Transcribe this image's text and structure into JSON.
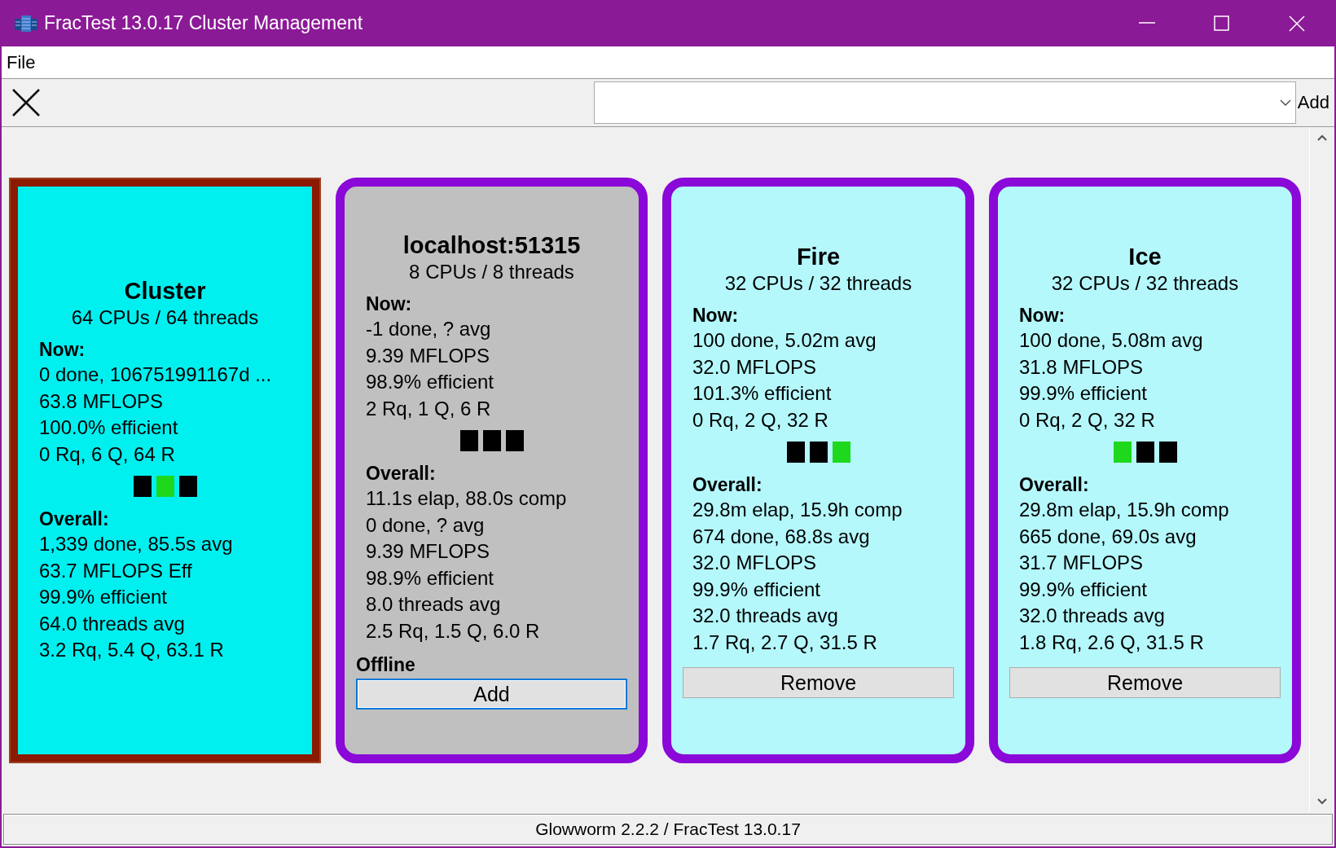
{
  "window": {
    "title": "FracTest 13.0.17 Cluster Management"
  },
  "menu": [
    "File"
  ],
  "toolbar": {
    "add_button": "Add"
  },
  "cards": [
    {
      "kind": "cluster",
      "color": "#00f0f0",
      "title": "Cluster",
      "subtitle": "64 CPUs / 64 threads",
      "now_label": "Now:",
      "now": [
        "0 done, 106751991167d ...",
        "63.8 MFLOPS",
        "100.0% efficient",
        "0 Rq, 6 Q, 64 R"
      ],
      "indicators": [
        {
          "on": false
        },
        {
          "on": true
        },
        {
          "on": false
        }
      ],
      "overall_label": "Overall:",
      "overall": [
        "1,339 done, 85.5s avg",
        "63.7 MFLOPS Eff",
        "99.9% efficient",
        "64.0 threads avg",
        "3.2 Rq, 5.4 Q, 63.1 R"
      ]
    },
    {
      "kind": "node",
      "color": "#c0c0c0",
      "title": "localhost:51315",
      "subtitle": "8 CPUs / 8 threads",
      "now_label": "Now:",
      "now": [
        "-1 done, ? avg",
        "9.39 MFLOPS",
        "98.9% efficient",
        "2 Rq, 1 Q, 6 R"
      ],
      "indicators": [
        {
          "on": false
        },
        {
          "on": false
        },
        {
          "on": false
        }
      ],
      "overall_label": "Overall:",
      "overall": [
        "11.1s elap, 88.0s comp",
        "0 done, ? avg",
        "9.39 MFLOPS",
        "98.9% efficient",
        "8.0 threads avg",
        "2.5 Rq, 1.5 Q, 6.0 R"
      ],
      "status": "Offline",
      "button": {
        "label": "Add",
        "focused": true
      }
    },
    {
      "kind": "node",
      "color": "#b4f8fc",
      "title": "Fire",
      "subtitle": "32 CPUs / 32 threads",
      "now_label": "Now:",
      "now": [
        "100 done, 5.02m avg",
        "32.0 MFLOPS",
        "101.3% efficient",
        "0 Rq, 2 Q, 32 R"
      ],
      "indicators": [
        {
          "on": false
        },
        {
          "on": false
        },
        {
          "on": true
        }
      ],
      "overall_label": "Overall:",
      "overall": [
        "29.8m elap, 15.9h comp",
        "674 done, 68.8s avg",
        "32.0 MFLOPS",
        "99.9% efficient",
        "32.0 threads avg",
        "1.7 Rq, 2.7 Q, 31.5 R"
      ],
      "button": {
        "label": "Remove",
        "focused": false
      }
    },
    {
      "kind": "node",
      "color": "#b4f8fc",
      "title": "Ice",
      "subtitle": "32 CPUs / 32 threads",
      "now_label": "Now:",
      "now": [
        "100 done, 5.08m avg",
        "31.8 MFLOPS",
        "99.9% efficient",
        "0 Rq, 2 Q, 32 R"
      ],
      "indicators": [
        {
          "on": true
        },
        {
          "on": false
        },
        {
          "on": false
        }
      ],
      "overall_label": "Overall:",
      "overall": [
        "29.8m elap, 15.9h comp",
        "665 done, 69.0s avg",
        "31.7 MFLOPS",
        "99.9% efficient",
        "32.0 threads avg",
        "1.8 Rq, 2.6 Q, 31.5 R"
      ],
      "button": {
        "label": "Remove",
        "focused": false
      }
    }
  ],
  "status_bar": "Glowworm 2.2.2 / FracTest 13.0.17"
}
